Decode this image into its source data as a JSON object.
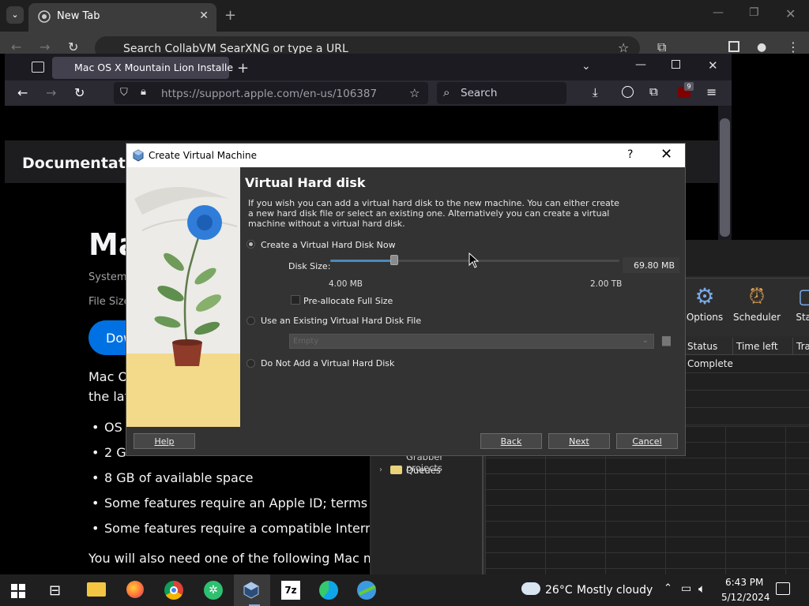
{
  "chrome": {
    "tab_title": "New Tab",
    "omnibox_text": "Search CollabVM SearXNG or type a URL"
  },
  "firefox": {
    "tab_title": "Mac OS X Mountain Lion Installe",
    "url_host": "https://support.apple.com",
    "url_path": "/en-us/106387",
    "search_label": "Search",
    "badge_count": "9"
  },
  "page": {
    "docbar_title": "Documentatio",
    "heading": "Ma",
    "meta_line1": "System",
    "meta_line2": "File Size",
    "download_label": "Dow",
    "intro_line1": "Mac O",
    "intro_line2": "the lat",
    "bullets": [
      "OS",
      "2 G",
      "8 GB of available space",
      "Some features require an Apple ID; terms ap",
      "Some features require a compatible Interne"
    ],
    "footer_line": "You will also need one of the following Mac mo"
  },
  "download_manager": {
    "tools": [
      "Options",
      "Scheduler",
      "Start"
    ],
    "columns": [
      "Status",
      "Time left",
      "Tra"
    ],
    "row_status": "Complete",
    "tree_items": [
      "Grabber projects",
      "Queues"
    ]
  },
  "vm_dialog": {
    "window_title": "Create Virtual Machine",
    "help_glyph": "?",
    "close_glyph": "✕",
    "heading": "Virtual Hard disk",
    "description": "If you wish you can add a virtual hard disk to the new machine. You can either create a new hard disk file or select an existing one. Alternatively you can create a virtual machine without a virtual hard disk.",
    "option_create": "Create a Virtual Hard Disk Now",
    "disk_size_label": "Disk Size:",
    "disk_size_value": "69.80 MB",
    "slider_min": "4.00 MB",
    "slider_max": "2.00 TB",
    "slider_fraction": 0.22,
    "prealloc_label": "Pre-allocate Full Size",
    "option_existing": "Use an Existing Virtual Hard Disk File",
    "file_placeholder": "Empty",
    "option_none": "Do Not Add a Virtual Hard Disk",
    "buttons": {
      "help": "Help",
      "back": "Back",
      "next": "Next",
      "cancel": "Cancel"
    }
  },
  "taskbar": {
    "weather_temp": "26°C",
    "weather_desc": "Mostly cloudy",
    "time": "6:43 PM",
    "date": "5/12/2024",
    "seven_zip_label": "7z"
  },
  "colors": {
    "apple_blue": "#0071e3",
    "vm_dialog_bg": "#333333",
    "taskbar_bg": "#1f1f1f"
  }
}
